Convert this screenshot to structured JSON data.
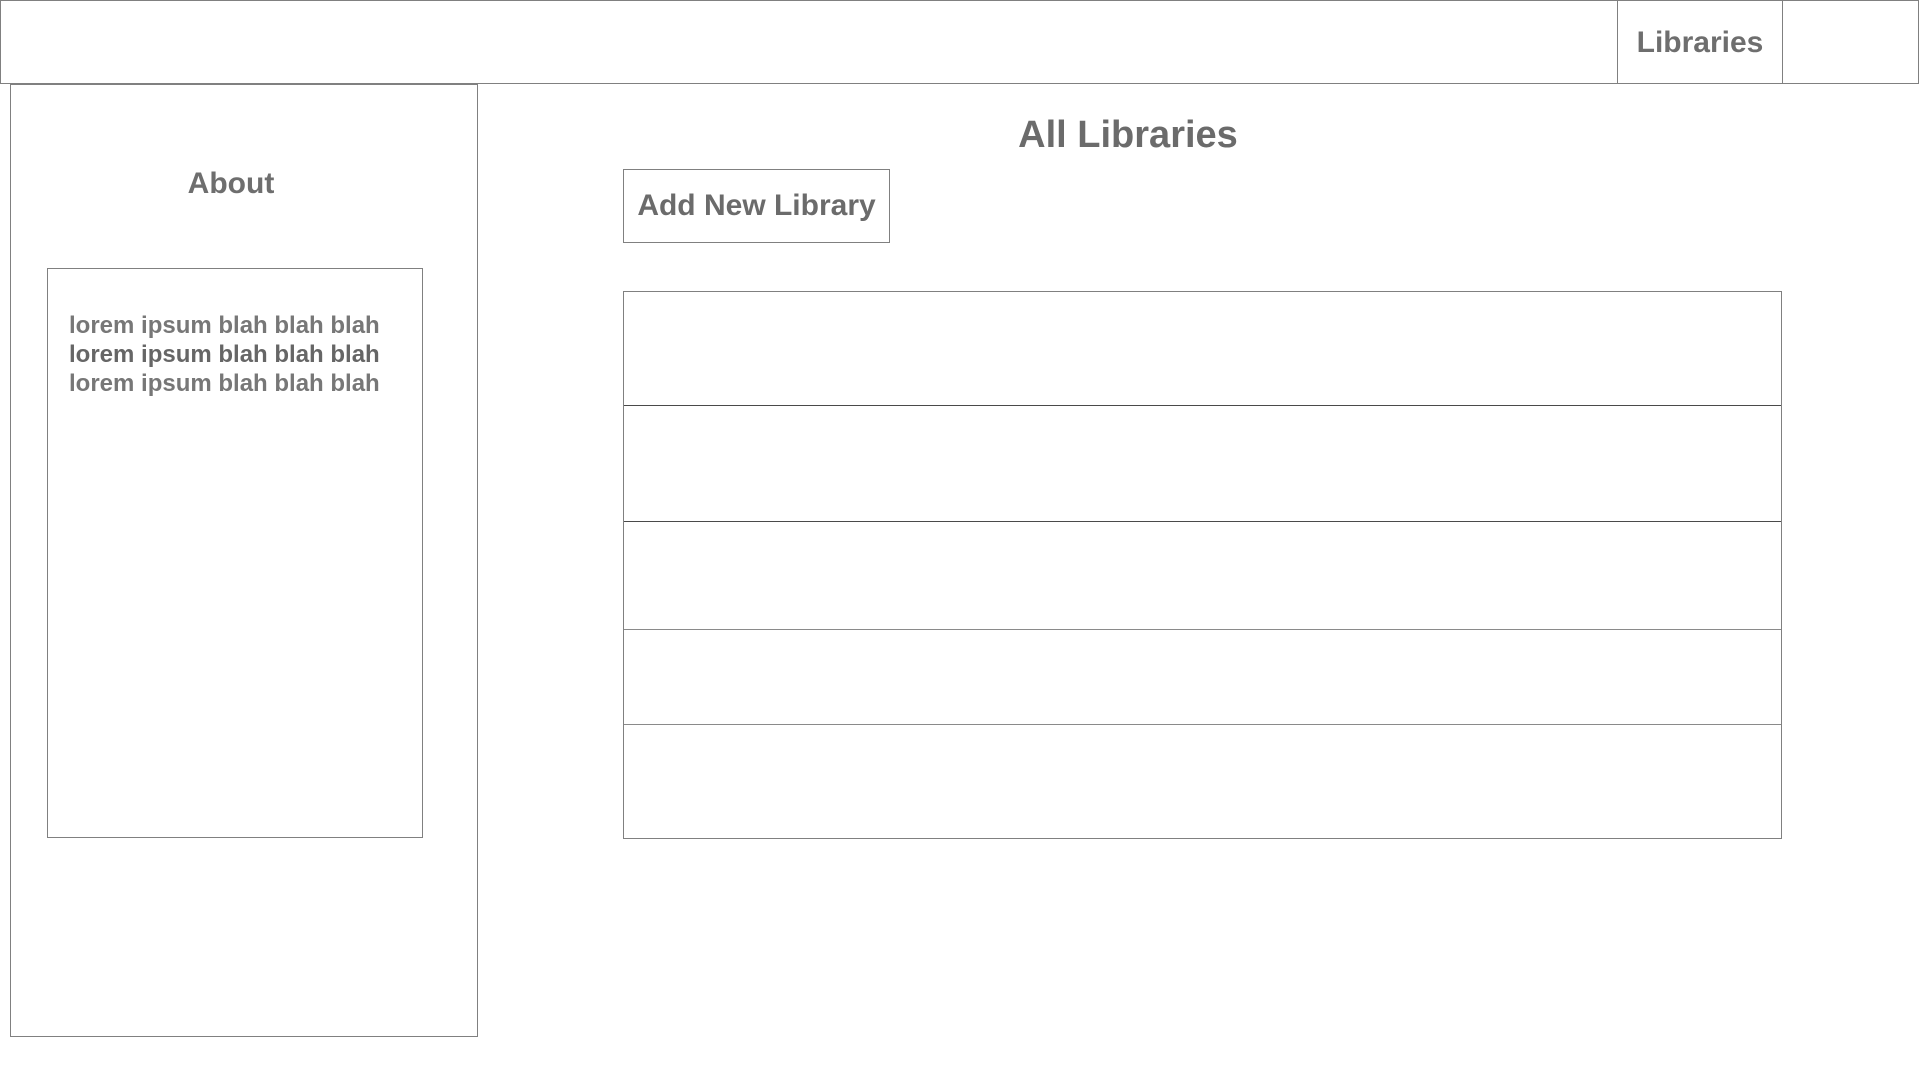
{
  "header": {
    "nav_libraries": "Libraries"
  },
  "sidebar": {
    "title": "About",
    "about_lines": [
      "lorem ipsum blah blah blah",
      "lorem ipsum blah blah blah",
      "lorem ipsum blah blah blah"
    ]
  },
  "main": {
    "title": "All Libraries",
    "add_button_label": "Add New Library",
    "library_rows": [
      "",
      "",
      "",
      "",
      ""
    ]
  }
}
